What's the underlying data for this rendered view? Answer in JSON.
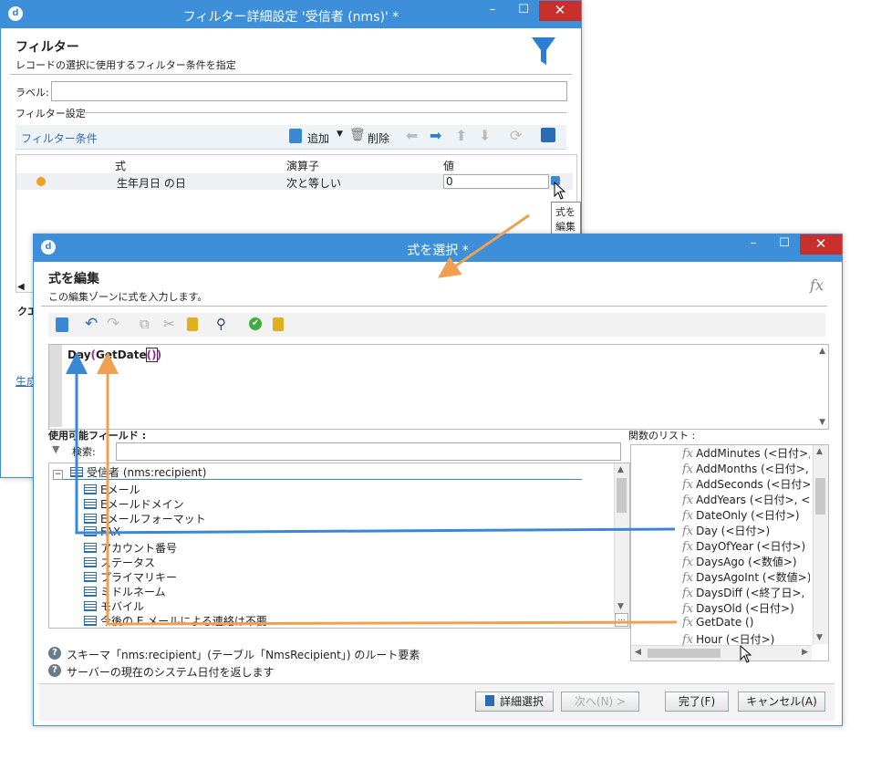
{
  "filter_window": {
    "title": "フィルター詳細設定 '受信者 (nms)' *",
    "header_title": "フィルター",
    "header_subtitle": "レコードの選択に使用するフィルター条件を指定",
    "label_label": "ラベル:",
    "label_value": "",
    "filter_settings_label": "フィルター設定",
    "conditions_link": "フィルター条件",
    "add_label": "追加",
    "delete_label": "削除",
    "columns": [
      "式",
      "演算子",
      "値"
    ],
    "row": {
      "expression": "生年月日 の日",
      "operator": "次と等しい",
      "value": "0"
    },
    "tooltip": "式を編集",
    "partial_query_label": "クエ",
    "partial_link": "生成"
  },
  "expr_window": {
    "title": "式を選択 *",
    "header_title": "式を編集",
    "header_subtitle": "この編集ゾーンに式を入力します。",
    "fx_label": "fx",
    "expression": {
      "func": "Day",
      "open": "(",
      "inner": "GetDate",
      "inner_args": "()",
      "close": ")"
    },
    "available_fields_label": "使用可能フィールド :",
    "search_label": "検索:",
    "function_list_label": "関数のリスト :",
    "tree_root": "受信者 (nms:recipient)",
    "tree_items": [
      "Eメール",
      "Eメールドメイン",
      "Eメールフォーマット",
      "FAX",
      "アカウント番号",
      "ステータス",
      "プライマリキー",
      "ミドルネーム",
      "モバイル",
      "今後の E メールによる連絡は不要"
    ],
    "functions": [
      "AddMinutes (<日付>, ",
      "AddMonths (<日付>, ",
      "AddSeconds (<日付>",
      "AddYears (<日付>, <",
      "DateOnly (<日付>)",
      "Day (<日付>)",
      "DayOfYear (<日付>)",
      "DaysAgo (<数値>)",
      "DaysAgoInt (<数値>)",
      "DaysDiff (<終了日>,",
      "DaysOld (<日付>)",
      "GetDate ()",
      "Hour (<日付>)"
    ],
    "help_lines": [
      "スキーマ「nms:recipient」(テーブル「NmsRecipient」) のルート要素",
      "サーバーの現在のシステム日付を返します"
    ],
    "buttons": {
      "advanced": "詳細選択",
      "next": "次へ(N) >",
      "finish": "完了(F)",
      "cancel": "キャンセル(A)"
    }
  },
  "colors": {
    "titlebar": "#3c8fd8",
    "blue_arrow": "#3a87d4",
    "orange_arrow": "#f0a050"
  }
}
